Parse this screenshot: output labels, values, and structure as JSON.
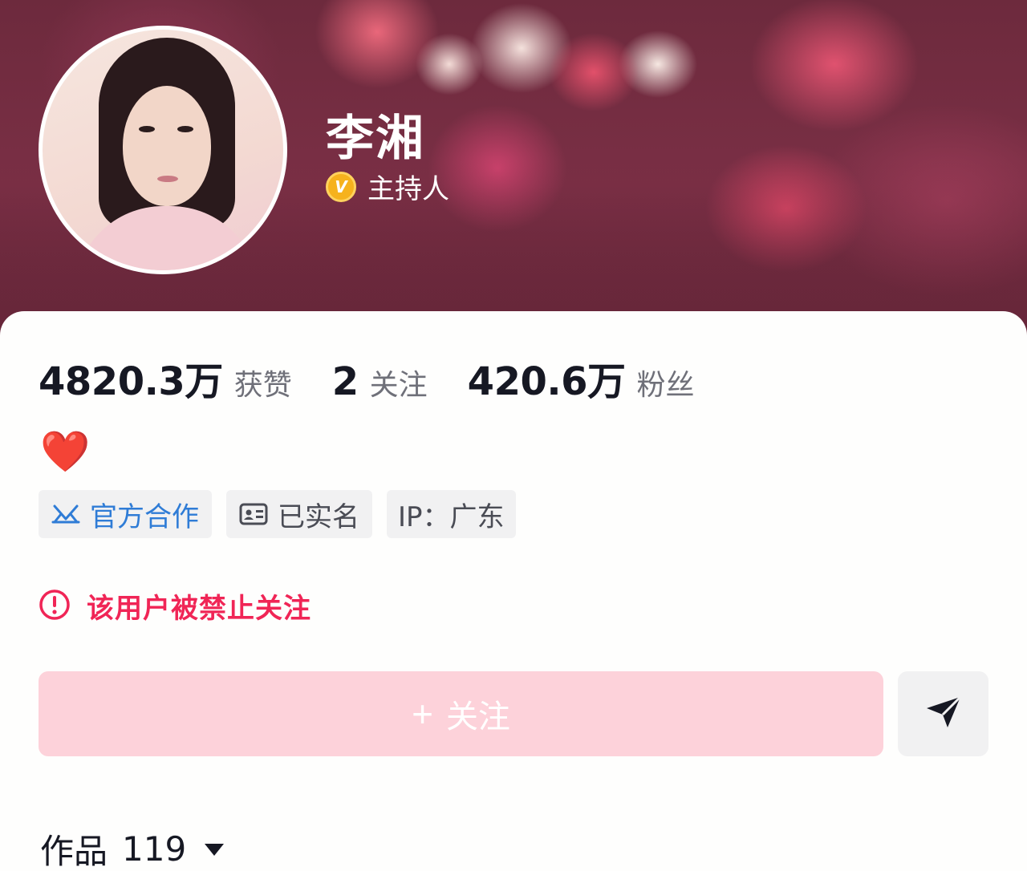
{
  "profile": {
    "name": "李湘",
    "role": "主持人",
    "verified_badge_letter": "V"
  },
  "stats": {
    "likes": {
      "value": "4820.3万",
      "label": "获赞"
    },
    "following": {
      "value": "2",
      "label": "关注"
    },
    "followers": {
      "value": "420.6万",
      "label": "粉丝"
    }
  },
  "bio": {
    "emoji": "❤️"
  },
  "tags": {
    "official": "官方合作",
    "verified_identity": "已实名",
    "ip": "IP：广东"
  },
  "notice": {
    "text": "该用户被禁止关注"
  },
  "actions": {
    "follow_plus": "+",
    "follow_label": "关注"
  },
  "works": {
    "label": "作品",
    "count": "119"
  },
  "colors": {
    "warning": "#f02556",
    "official_tag": "#2f7cd6",
    "follow_button_bg": "#fdd2da",
    "badge_gold": "#f6b21d"
  },
  "icons": {
    "official": "official-cooperation-icon",
    "id_card": "id-card-icon",
    "warning": "exclamation-circle-icon",
    "share": "send-arrow-icon",
    "caret": "caret-down-icon"
  }
}
